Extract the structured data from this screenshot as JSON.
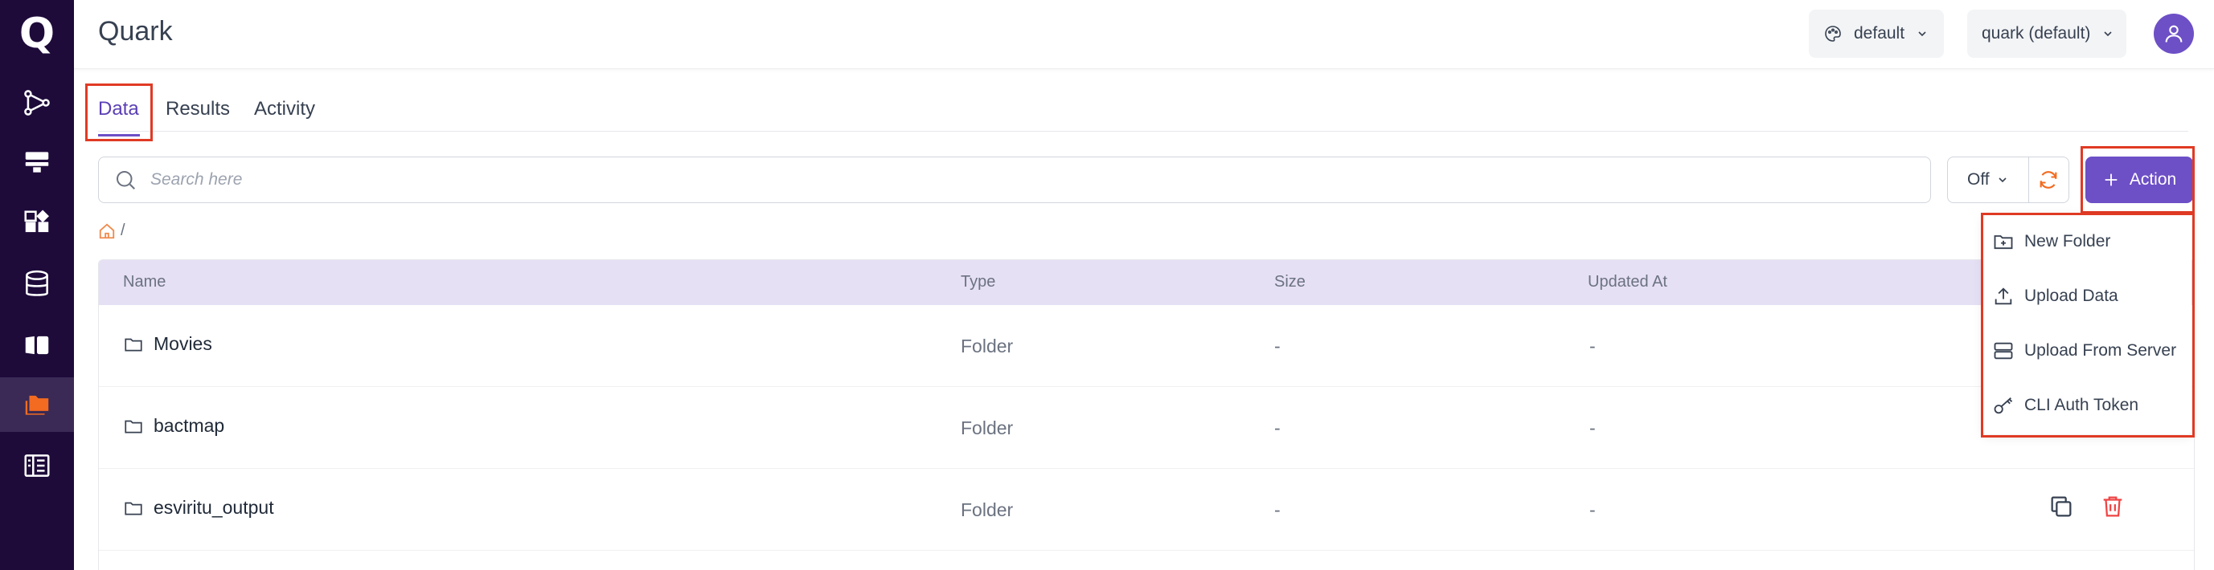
{
  "app": {
    "title": "Quark"
  },
  "header": {
    "theme_value": "default",
    "project_value": "quark (default)"
  },
  "tabs": [
    {
      "label": "Data",
      "active": true
    },
    {
      "label": "Results",
      "active": false
    },
    {
      "label": "Activity",
      "active": false
    }
  ],
  "toolbar": {
    "search_placeholder": "Search here",
    "refresh_interval": "Off",
    "action_label": "Action"
  },
  "breadcrumb": {
    "separator": "/"
  },
  "table": {
    "columns": [
      "Name",
      "Type",
      "Size",
      "Updated At"
    ],
    "rows": [
      {
        "name": "Movies",
        "type": "Folder",
        "size": "-",
        "updated_at": "-"
      },
      {
        "name": "bactmap",
        "type": "Folder",
        "size": "-",
        "updated_at": "-"
      },
      {
        "name": "esviritu_output",
        "type": "Folder",
        "size": "-",
        "updated_at": "-"
      }
    ]
  },
  "action_menu": {
    "items": [
      {
        "label": "New Folder",
        "icon": "folder-plus-icon"
      },
      {
        "label": "Upload Data",
        "icon": "upload-icon"
      },
      {
        "label": "Upload From Server",
        "icon": "server-icon"
      },
      {
        "label": "CLI Auth Token",
        "icon": "key-icon"
      }
    ]
  },
  "colors": {
    "sidebar_bg": "#1e0b3a",
    "accent": "#6d4fc6",
    "table_header_bg": "#e6e0f5",
    "highlight": "#e03a24",
    "home_icon": "#f08a4b",
    "refresh_icon": "#f26b21",
    "delete_icon": "#ef4444"
  }
}
